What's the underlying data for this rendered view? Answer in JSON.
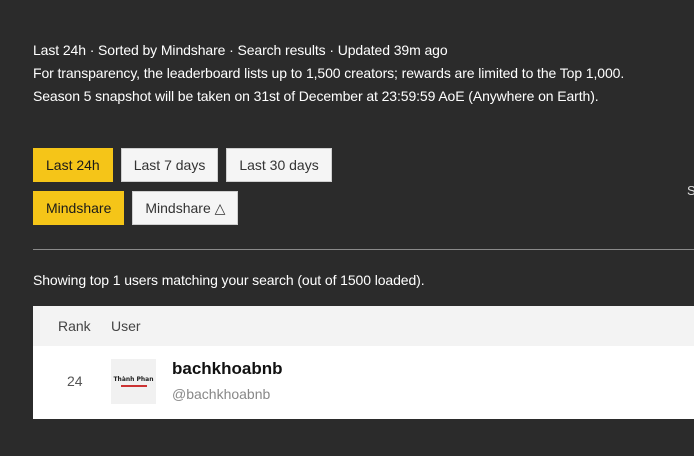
{
  "info": {
    "line1": "Last 24h · Sorted by Mindshare · Search results · Updated 39m ago",
    "line2": "For transparency, the leaderboard lists up to 1,500 creators; rewards are limited to the Top 1,000.",
    "line3": "Season 5 snapshot will be taken on 31st of December at 23:59:59 AoE (Anywhere on Earth)."
  },
  "time_filters": [
    {
      "label": "Last 24h",
      "active": true
    },
    {
      "label": "Last 7 days",
      "active": false
    },
    {
      "label": "Last 30 days",
      "active": false
    }
  ],
  "sort_filters": [
    {
      "label": "Mindshare",
      "active": true
    },
    {
      "label": "Mindshare △",
      "active": false
    }
  ],
  "side_glyph": "S",
  "showing_text": "Showing top 1 users matching your search (out of 1500 loaded).",
  "table": {
    "headers": {
      "rank": "Rank",
      "user": "User"
    },
    "rows": [
      {
        "rank": "24",
        "name": "bachkhoabnb",
        "handle": "@bachkhoabnb",
        "avatar_text": "Thành Phan"
      }
    ]
  },
  "colors": {
    "active": "#f5c518",
    "background": "#2b2b2b"
  }
}
